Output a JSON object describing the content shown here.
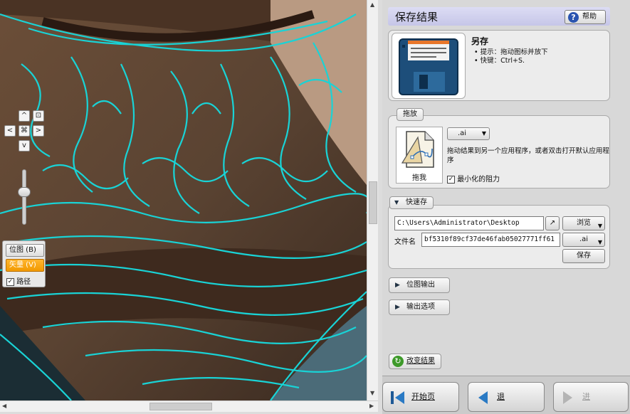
{
  "canvas": {
    "nav": {
      "up": "^",
      "down": "v",
      "left": "<",
      "right": ">",
      "center": "⌘",
      "fit": "⊡"
    },
    "view_panel": {
      "bitmap_label": "位图 (B)",
      "vector_label": "矢量 (V)",
      "path_label": "路径",
      "path_checked": true
    }
  },
  "side": {
    "title": "保存结果",
    "help_label": "帮助",
    "saveas": {
      "title": "另存",
      "tip1": "• 提示：拖动图标并放下",
      "tip2": "• 快键：Ctrl+S."
    },
    "drag": {
      "tab_label": "拖放",
      "icon_label": "拖我",
      "format": ".ai",
      "description": "拖动结果到另一个应用程序，或者双击打开默认应用程序",
      "minimize_label": "最小化的阻力",
      "minimize_checked": true
    },
    "quick": {
      "tab_label": "快速存",
      "path_value": "C:\\Users\\Administrator\\Desktop",
      "browse_label": "浏览",
      "filename_label": "文件名",
      "filename_value": "bf5310f89cf37de46fab05027771ff61",
      "format": ".ai",
      "save_label": "保存"
    },
    "bitmap_output_label": "位图输出",
    "output_options_label": "输出选项",
    "change_result_label": "改变结果",
    "footer": {
      "start_label": "开始页",
      "back_label": "退",
      "forward_label": "进"
    }
  },
  "colors": {
    "vector_active": "#f29a00",
    "trace_lines": "#19d3d6",
    "title_bar": "#c6c6e8"
  }
}
